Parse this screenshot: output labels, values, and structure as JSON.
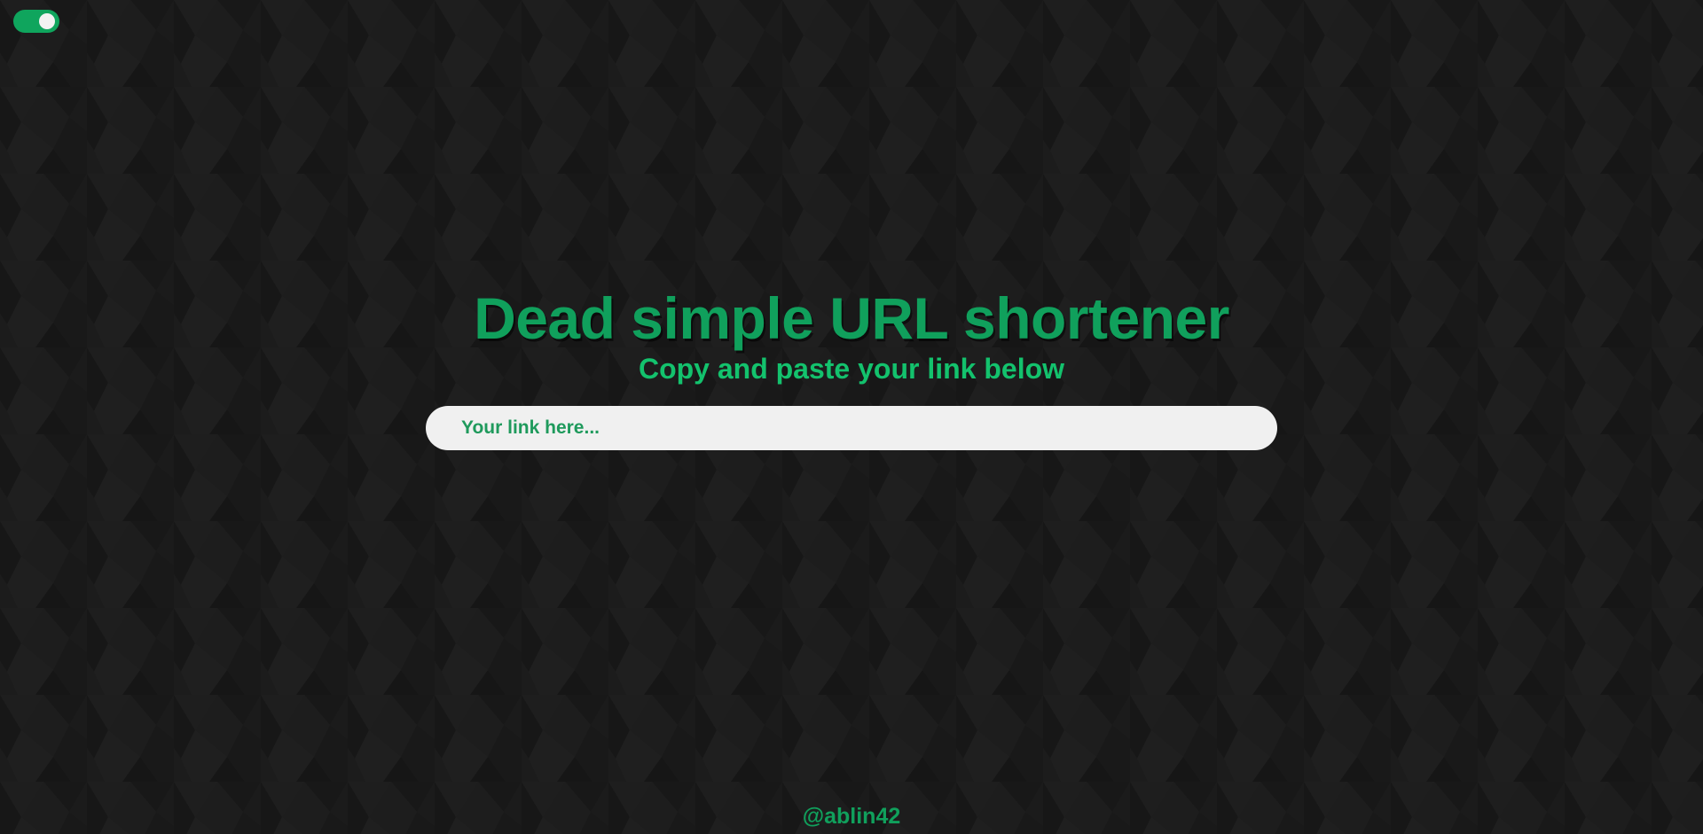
{
  "colors": {
    "accent": "#10a05c",
    "accent_light": "#13c26d",
    "background": "#1b1b1b",
    "input_background": "#f0f0f0",
    "toggle_on": "#0fa55d"
  },
  "theme_toggle": {
    "icon": "toggle-switch-icon",
    "state": "on"
  },
  "hero": {
    "title": "Dead simple URL shortener",
    "subtitle": "Copy and paste your link below"
  },
  "link_input": {
    "value": "",
    "placeholder": "Your link here..."
  },
  "footer": {
    "handle": "@ablin42"
  }
}
